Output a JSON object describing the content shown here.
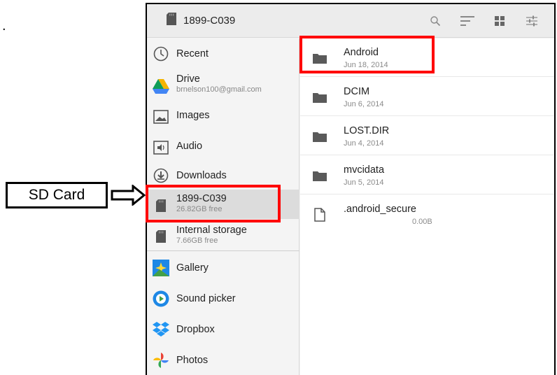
{
  "annotation": {
    "callout_label": "SD Card",
    "stray_mark": "."
  },
  "appbar": {
    "title": "1899-C039",
    "actions": [
      "search-icon",
      "sort-icon",
      "grid-view-icon",
      "settings-sliders-icon"
    ]
  },
  "drawer": {
    "items": [
      {
        "label": "Recent",
        "icon": "clock-icon"
      },
      {
        "label": "Drive",
        "sub": "brnelson100@gmail.com",
        "icon": "google-drive-icon"
      },
      {
        "label": "Images",
        "icon": "image-icon"
      },
      {
        "label": "Audio",
        "icon": "audio-icon"
      },
      {
        "label": "Downloads",
        "icon": "download-icon"
      },
      {
        "label": "1899-C039",
        "sub": "26.82GB free",
        "icon": "sd-card-icon",
        "selected": true
      },
      {
        "label": "Internal storage",
        "sub": "7.66GB free",
        "icon": "storage-icon"
      },
      {
        "label": "Gallery",
        "icon": "gallery-icon"
      },
      {
        "label": "Sound picker",
        "icon": "sound-picker-icon"
      },
      {
        "label": "Dropbox",
        "icon": "dropbox-icon"
      },
      {
        "label": "Photos",
        "icon": "photos-icon"
      }
    ]
  },
  "files": [
    {
      "name": "Android",
      "date": "Jun 18, 2014",
      "icon": "folder-icon"
    },
    {
      "name": "DCIM",
      "date": "Jun 6, 2014",
      "icon": "folder-icon"
    },
    {
      "name": "LOST.DIR",
      "date": "Jun 4, 2014",
      "icon": "folder-icon"
    },
    {
      "name": "mvcidata",
      "date": "Jun 5, 2014",
      "icon": "folder-icon"
    },
    {
      "name": ".android_secure",
      "size": "0.00B",
      "icon": "file-icon"
    }
  ],
  "colors": {
    "highlight": "#ff0000",
    "selected_bg": "#dcdcdc",
    "folder": "#5a5a5a"
  }
}
